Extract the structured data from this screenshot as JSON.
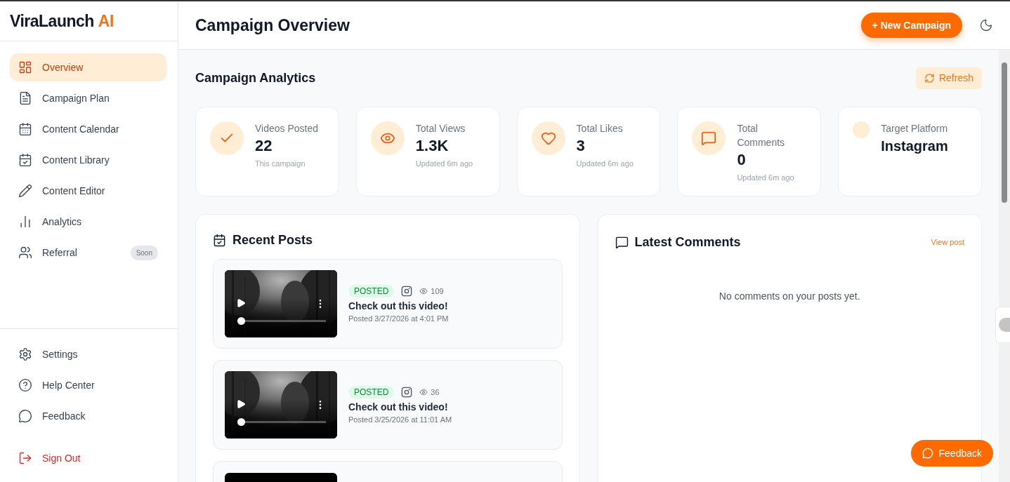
{
  "brand": {
    "name": "ViraLaunch",
    "accent": "AI"
  },
  "sidebar": {
    "items": [
      {
        "label": "Overview",
        "selected": true
      },
      {
        "label": "Campaign Plan",
        "selected": false
      },
      {
        "label": "Content Calendar",
        "selected": false
      },
      {
        "label": "Content Library",
        "selected": false
      },
      {
        "label": "Content Editor",
        "selected": false
      },
      {
        "label": "Analytics",
        "selected": false
      },
      {
        "label": "Referral",
        "selected": false,
        "badge": "Soon"
      }
    ],
    "footer_items": [
      {
        "label": "Settings",
        "kind": "normal"
      },
      {
        "label": "Help Center",
        "kind": "normal"
      },
      {
        "label": "Feedback",
        "kind": "normal"
      },
      {
        "label": "Sign Out",
        "kind": "danger"
      }
    ]
  },
  "header": {
    "title": "Campaign Overview",
    "primary_button": "+ New Campaign"
  },
  "analytics": {
    "title": "Campaign Analytics",
    "refresh_button": "Refresh",
    "stats": [
      {
        "kind": "metric",
        "label": "Videos Posted",
        "value": "22",
        "note": "This campaign"
      },
      {
        "kind": "metric",
        "label": "Total Views",
        "value": "1.3K",
        "note": "Updated 6m ago"
      },
      {
        "kind": "metric",
        "label": "Total Likes",
        "value": "3",
        "note": "Updated 6m ago"
      },
      {
        "kind": "metric",
        "label": "Total Comments",
        "value": "0",
        "note": "Updated 6m ago"
      },
      {
        "kind": "platform",
        "label": "Target Platform",
        "value": "Instagram"
      }
    ]
  },
  "recent_posts": {
    "title": "Recent Posts",
    "posts": [
      {
        "kind": "full",
        "status": "POSTED",
        "views": "109",
        "title": "Check out this video!",
        "posted": "Posted 3/27/2026 at 4:01 PM",
        "level": 0
      },
      {
        "kind": "full",
        "status": "POSTED",
        "views": "36",
        "title": "Check out this video!",
        "posted": "Posted 3/25/2026 at 11:01 AM",
        "level": 0
      },
      {
        "kind": "clipped"
      }
    ]
  },
  "latest_comments": {
    "title": "Latest Comments",
    "link": "View post",
    "empty": "No comments on your posts yet."
  },
  "feedback_button": "Feedback"
}
